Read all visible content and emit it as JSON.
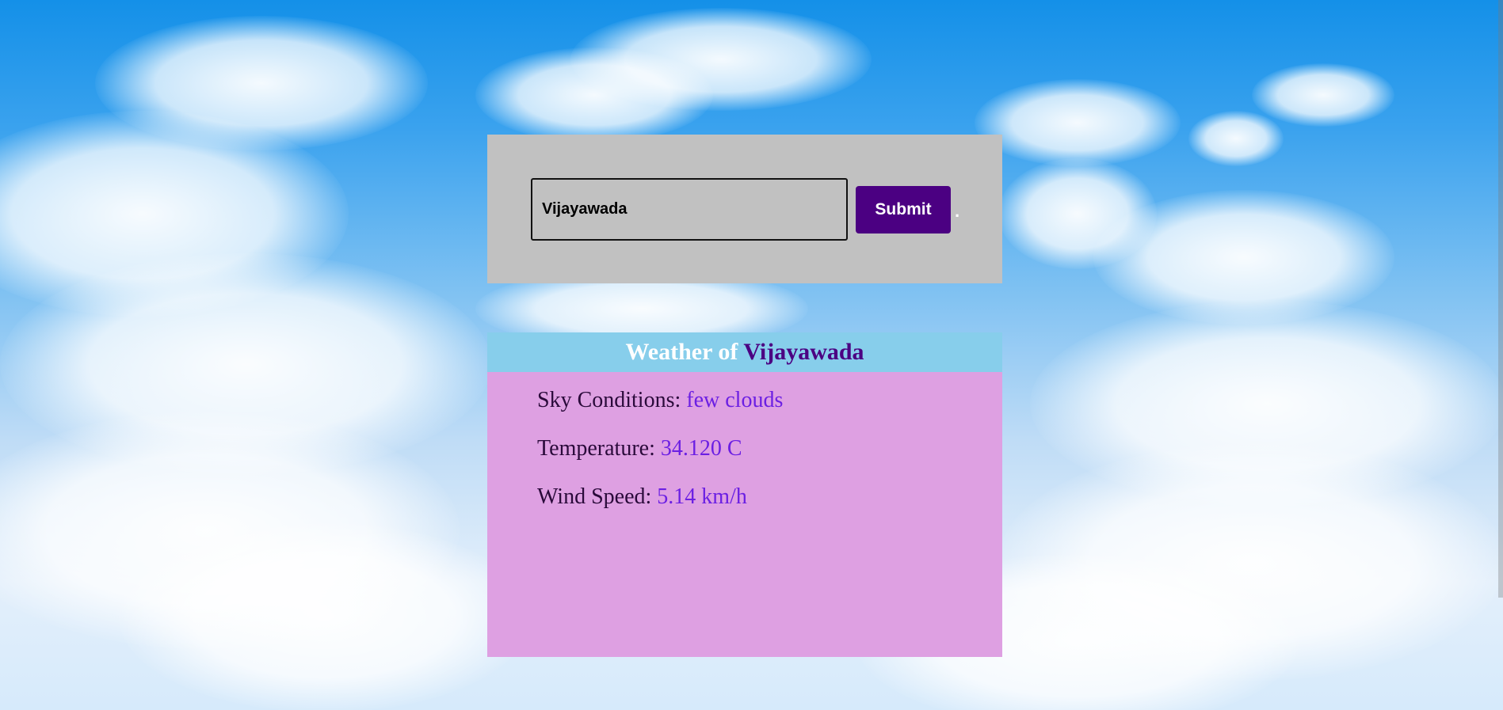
{
  "search": {
    "value": "Vijayawada",
    "submit_label": "Submit",
    "trailing_mark": "."
  },
  "weather": {
    "header_prefix": "Weather of",
    "city": "Vijayawada",
    "rows": [
      {
        "label": "Sky Conditions:",
        "value": "few clouds"
      },
      {
        "label": "Temperature:",
        "value": "34.120 C"
      },
      {
        "label": "Wind Speed:",
        "value": "5.14 km/h"
      }
    ]
  },
  "colors": {
    "panel_bg": "#c1c1c1",
    "button_bg": "#4b0082",
    "card_bg": "#dea0e2",
    "header_bg": "#87ceeb",
    "value_color": "#6b1fe3"
  }
}
